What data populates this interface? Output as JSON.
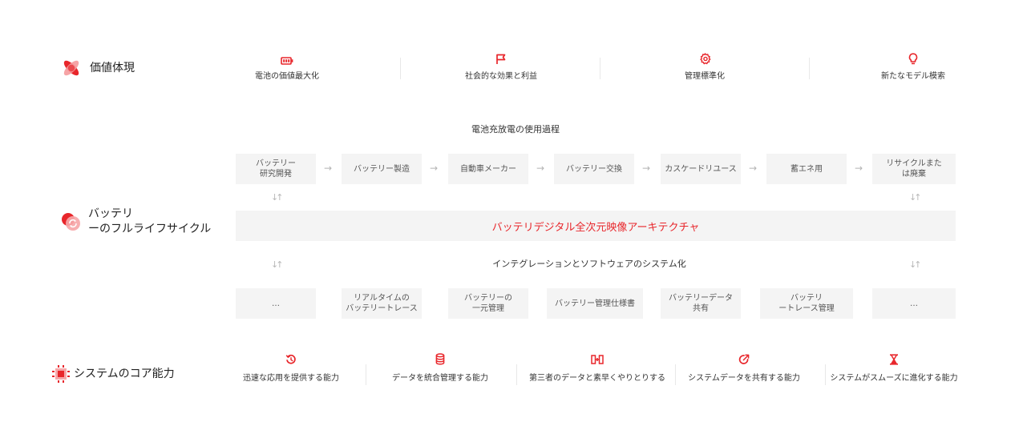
{
  "value_section": {
    "title": "価値体現",
    "items": [
      {
        "label": "電池の価値最大化",
        "icon": "battery-icon"
      },
      {
        "label": "社会的な効果と利益",
        "icon": "flag-icon"
      },
      {
        "label": "管理標準化",
        "icon": "gear-icon"
      },
      {
        "label": "新たなモデル模索",
        "icon": "lightbulb-icon"
      }
    ]
  },
  "lifecycle": {
    "title_line1": "バッテリ",
    "title_line2": "ーのフルライフサイクル",
    "flow_title": "電池充放電の使用過程",
    "flow_steps": [
      "バッテリー\n研究開発",
      "バッテリー製造",
      "自動車メーカー",
      "バッテリー交換",
      "カスケードリユース",
      "蓄エネ用",
      "リサイクルまた\nは廃棄"
    ],
    "arrow_glyph": "→",
    "swap_glyph": "↓↑",
    "architecture": "バッテリデジタル全次元映像アーキテクチャ",
    "integration_title": "インテグレーションとソフトウェアのシステム化",
    "integration_items": [
      "…",
      "リアルタイムの\nバッテリートレース",
      "バッテリーの\n一元管理",
      "バッテリー管理仕様書",
      "バッテリーデータ\n共有",
      "バッテリ\nートレース管理",
      "…"
    ]
  },
  "capabilities": {
    "title": "システムのコア能力",
    "items": [
      {
        "label": "迅速な応用を提供する能力",
        "icon": "refresh-icon"
      },
      {
        "label": "データを統合管理する能力",
        "icon": "database-icon"
      },
      {
        "label": "第三者のデータと素早くやりとりする",
        "icon": "exchange-icon"
      },
      {
        "label": "システムデータを共有する能力",
        "icon": "share-icon"
      },
      {
        "label": "システムがスムーズに進化する能力",
        "icon": "hourglass-icon"
      }
    ]
  },
  "colors": {
    "accent": "#e8262b",
    "box_bg": "#f4f4f4",
    "text": "#333333",
    "arrow": "#b4b4b4"
  }
}
